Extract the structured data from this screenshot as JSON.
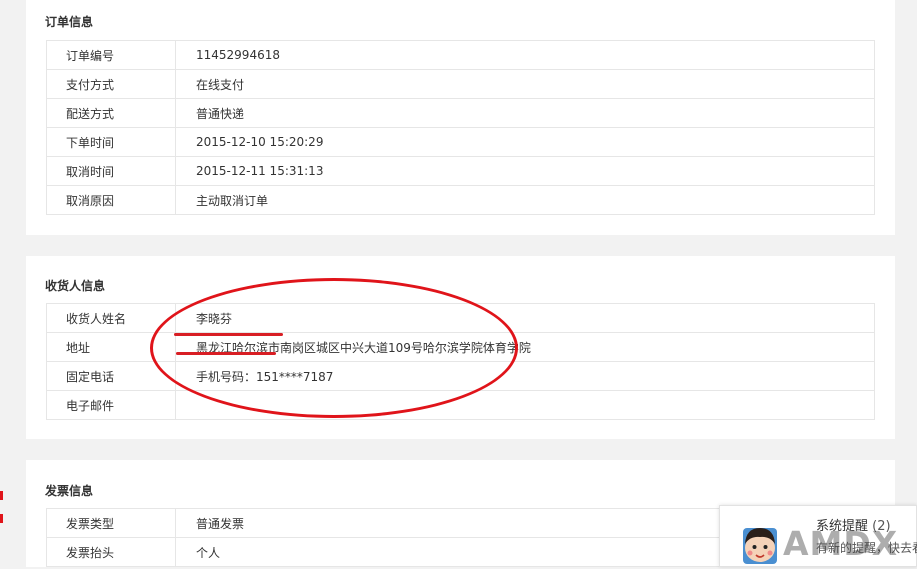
{
  "order_section": {
    "title": "订单信息",
    "rows": [
      {
        "label": "订单编号",
        "value": "11452994618"
      },
      {
        "label": "支付方式",
        "value": "在线支付"
      },
      {
        "label": "配送方式",
        "value": "普通快递"
      },
      {
        "label": "下单时间",
        "value": "2015-12-10 15:20:29"
      },
      {
        "label": "取消时间",
        "value": "2015-12-11 15:31:13"
      },
      {
        "label": "取消原因",
        "value": "主动取消订单"
      }
    ]
  },
  "receiver_section": {
    "title": "收货人信息",
    "rows": [
      {
        "label": "收货人姓名",
        "value": "李晓芬"
      },
      {
        "label": "地址",
        "value": "黑龙江哈尔滨市南岗区城区中兴大道109号哈尔滨学院体育学院"
      },
      {
        "label": "固定电话",
        "value": "手机号码：151****7187"
      },
      {
        "label": "电子邮件",
        "value": ""
      }
    ]
  },
  "invoice_section": {
    "title": "发票信息",
    "rows": [
      {
        "label": "发票类型",
        "value": "普通发票"
      },
      {
        "label": "发票抬头",
        "value": "个人"
      }
    ]
  },
  "notification": {
    "title": "系统提醒",
    "count": "(2)",
    "text": "有新的提醒，快去看看",
    "icon": "avatar-cartoon-icon"
  },
  "watermark": {
    "text": "AMDX"
  },
  "colors": {
    "annotation_red": "#e0141a",
    "page_bg": "#f2f2f2",
    "border": "#e6e6e6"
  }
}
